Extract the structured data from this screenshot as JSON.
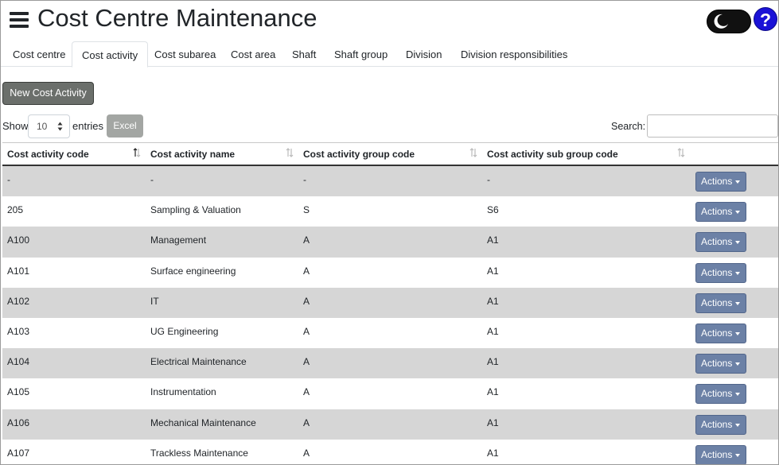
{
  "header": {
    "title": "Cost Centre Maintenance",
    "help_label": "?"
  },
  "tabs": [
    {
      "label": "Cost centre",
      "active": false
    },
    {
      "label": "Cost activity",
      "active": true
    },
    {
      "label": "Cost subarea",
      "active": false
    },
    {
      "label": "Cost area",
      "active": false
    },
    {
      "label": "Shaft",
      "active": false
    },
    {
      "label": "Shaft group",
      "active": false
    },
    {
      "label": "Division",
      "active": false
    },
    {
      "label": "Division responsibilities",
      "active": false
    }
  ],
  "toolbar": {
    "new_label": "New Cost Activity",
    "show_label": "Show",
    "length_value": "10",
    "entries_label": "entries",
    "excel_label": "Excel",
    "search_label": "Search:",
    "search_value": "",
    "search_placeholder": ""
  },
  "table": {
    "columns": [
      "Cost activity code",
      "Cost activity name",
      "Cost activity group code",
      "Cost activity sub group code"
    ],
    "actions_label": "Actions",
    "rows": [
      [
        "-",
        "-",
        "-",
        "-"
      ],
      [
        "205",
        "Sampling & Valuation",
        "S",
        "S6"
      ],
      [
        "A100",
        "Management",
        "A",
        "A1"
      ],
      [
        "A101",
        "Surface engineering",
        "A",
        "A1"
      ],
      [
        "A102",
        "IT",
        "A",
        "A1"
      ],
      [
        "A103",
        "UG Engineering",
        "A",
        "A1"
      ],
      [
        "A104",
        "Electrical Maintenance",
        "A",
        "A1"
      ],
      [
        "A105",
        "Instrumentation",
        "A",
        "A1"
      ],
      [
        "A106",
        "Mechanical Maintenance",
        "A",
        "A1"
      ],
      [
        "A107",
        "Trackless Maintenance",
        "A",
        "A1"
      ]
    ]
  },
  "colors": {
    "help": "#1a12d6",
    "actions": "#6c81a6",
    "new_button": "#6b6f6b",
    "excel_button": "#a3a6a3",
    "row_stripe": "#d6d6d6"
  },
  "icons": {
    "menu": "hamburger-icon",
    "theme": "moon-icon",
    "sort": "sort-arrows-icon",
    "dropdown": "caret-down-icon"
  }
}
